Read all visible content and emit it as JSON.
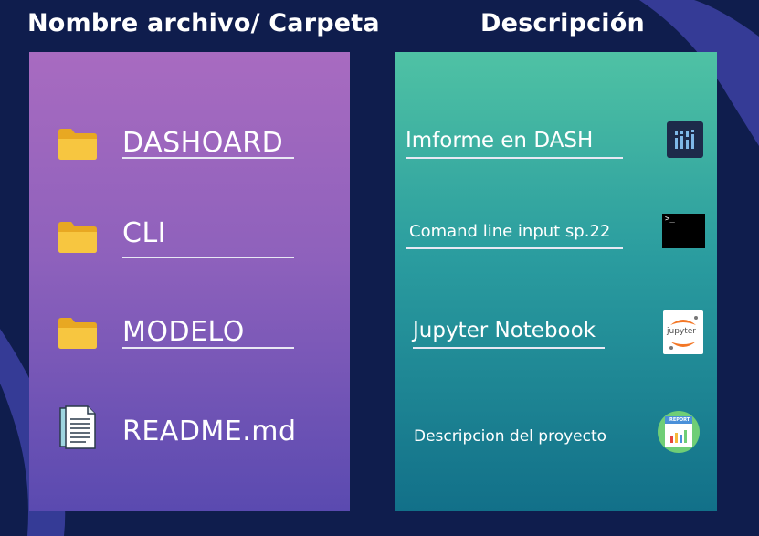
{
  "headers": {
    "left": "Nombre archivo/ Carpeta",
    "right": "Descripción"
  },
  "files": [
    {
      "name": "DASHOARD",
      "icon": "folder-icon"
    },
    {
      "name": "CLI",
      "icon": "folder-icon"
    },
    {
      "name": "MODELO",
      "icon": "folder-icon"
    },
    {
      "name": "README.md",
      "icon": "document-icon"
    }
  ],
  "descriptions": [
    {
      "text": "Imforme en DASH",
      "icon": "dash-logo-icon"
    },
    {
      "text": "Comand line input sp.22",
      "icon": "terminal-icon"
    },
    {
      "text": "Jupyter Notebook",
      "icon": "jupyter-logo-icon"
    },
    {
      "text": "Descripcion del proyecto",
      "icon": "report-icon"
    }
  ],
  "icon_text": {
    "terminal_prompt": ">_",
    "jupyter": "jupyter",
    "report": "REPORT"
  },
  "colors": {
    "background": "#0f1d4d",
    "left_panel_top": "#a86bc0",
    "left_panel_bottom": "#5a4ab0",
    "right_panel_top": "#4fc2a4",
    "right_panel_bottom": "#127089",
    "folder": "#f5c13a"
  }
}
